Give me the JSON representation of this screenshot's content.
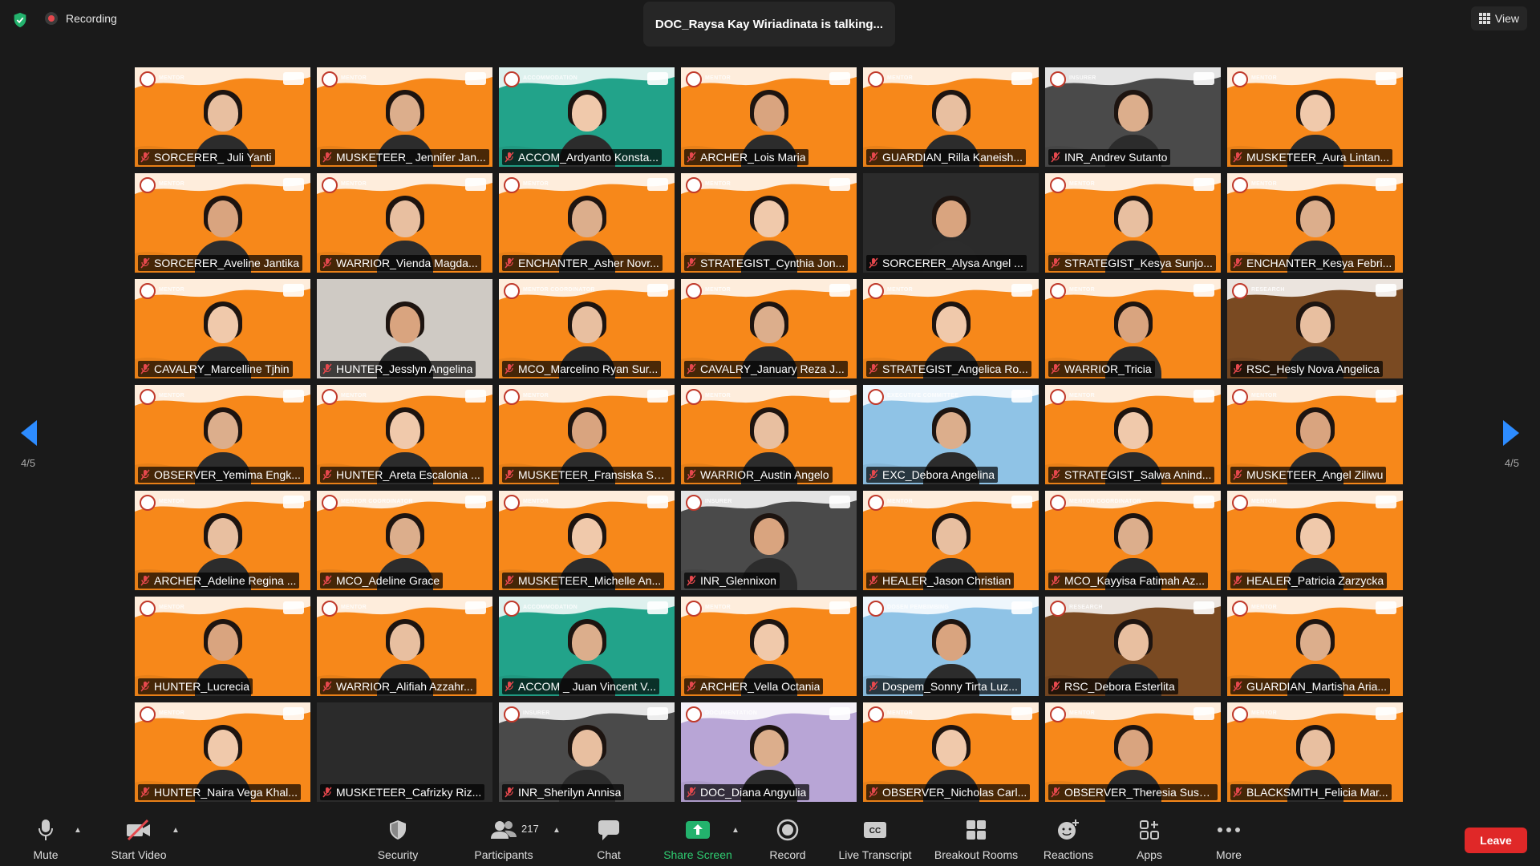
{
  "topbar": {
    "recording_label": "Recording",
    "talking_label": "DOC_Raysa Kay Wiriadinata is talking...",
    "view_label": "View"
  },
  "pager": {
    "left": "4/5",
    "right": "4/5"
  },
  "participants": [
    {
      "name": "SORCERER_ Juli Yanti",
      "role": "mentor",
      "bg": "orange"
    },
    {
      "name": "MUSKETEER_ Jennifer Jan...",
      "role": "mentor",
      "bg": "orange"
    },
    {
      "name": "ACCOM_Ardyanto Konsta...",
      "role": "accommodation",
      "bg": "teal"
    },
    {
      "name": "ARCHER_Lois Maria",
      "role": "mentor",
      "bg": "orange"
    },
    {
      "name": "GUARDIAN_Rilla Kaneish...",
      "role": "mentor",
      "bg": "orange"
    },
    {
      "name": "INR_Andrev Sutanto",
      "role": "insurer",
      "bg": "gray"
    },
    {
      "name": "MUSKETEER_Aura Lintan...",
      "role": "mentor",
      "bg": "orange"
    },
    {
      "name": "SORCERER_Aveline Jantika",
      "role": "mentor",
      "bg": "orange"
    },
    {
      "name": "WARRIOR_Vienda Magda...",
      "role": "mentor",
      "bg": "orange"
    },
    {
      "name": "ENCHANTER_Asher Novr...",
      "role": "mentor",
      "bg": "orange"
    },
    {
      "name": "STRATEGIST_Cynthia Jon...",
      "role": "mentor",
      "bg": "orange"
    },
    {
      "name": "SORCERER_Alysa Angel ...",
      "role": "mentor",
      "bg": "plain"
    },
    {
      "name": "STRATEGIST_Kesya Sunjo...",
      "role": "mentor",
      "bg": "orange"
    },
    {
      "name": "ENCHANTER_Kesya Febri...",
      "role": "mentor",
      "bg": "orange"
    },
    {
      "name": "CAVALRY_Marcelline Tjhin",
      "role": "mentor",
      "bg": "orange"
    },
    {
      "name": "HUNTER_Jesslyn Angelina",
      "role": "",
      "bg": "bg-cam"
    },
    {
      "name": "MCO_Marcelino Ryan Sur...",
      "role": "mentor coordinator",
      "bg": "orange"
    },
    {
      "name": "CAVALRY_January Reza J...",
      "role": "mentor",
      "bg": "orange"
    },
    {
      "name": "STRATEGIST_Angelica Ro...",
      "role": "mentor",
      "bg": "orange"
    },
    {
      "name": "WARRIOR_Tricia",
      "role": "mentor",
      "bg": "orange"
    },
    {
      "name": "RSC_Hesly Nova Angelica",
      "role": "research",
      "bg": "brown"
    },
    {
      "name": "OBSERVER_Yemima Engk...",
      "role": "mentor",
      "bg": "orange"
    },
    {
      "name": "HUNTER_Areta Escalonia ...",
      "role": "mentor",
      "bg": "orange"
    },
    {
      "name": "MUSKETEER_Fransiska Sz...",
      "role": "mentor",
      "bg": "orange"
    },
    {
      "name": "WARRIOR_Austin Angelo",
      "role": "mentor",
      "bg": "orange"
    },
    {
      "name": "EXC_Debora Angelina",
      "role": "executive committee",
      "bg": "blue"
    },
    {
      "name": "STRATEGIST_Salwa Anind...",
      "role": "mentor",
      "bg": "orange"
    },
    {
      "name": "MUSKETEER_Angel Ziliwu",
      "role": "mentor",
      "bg": "orange"
    },
    {
      "name": "ARCHER_Adeline Regina ...",
      "role": "mentor",
      "bg": "orange"
    },
    {
      "name": "MCO_Adeline Grace",
      "role": "mentor coordinator",
      "bg": "orange"
    },
    {
      "name": "MUSKETEER_Michelle An...",
      "role": "mentor",
      "bg": "orange"
    },
    {
      "name": "INR_Glennixon",
      "role": "insurer",
      "bg": "gray"
    },
    {
      "name": "HEALER_Jason Christian",
      "role": "mentor",
      "bg": "orange"
    },
    {
      "name": "MCO_Kayyisa Fatimah Az...",
      "role": "mentor coordinator",
      "bg": "orange"
    },
    {
      "name": "HEALER_Patricia Zarzycka",
      "role": "mentor",
      "bg": "orange"
    },
    {
      "name": "HUNTER_Lucrecia",
      "role": "mentor",
      "bg": "orange"
    },
    {
      "name": "WARRIOR_Alifiah Azzahr...",
      "role": "mentor",
      "bg": "orange"
    },
    {
      "name": "ACCOM _ Juan Vincent V...",
      "role": "accommodation",
      "bg": "teal"
    },
    {
      "name": "ARCHER_Vella Octania",
      "role": "mentor",
      "bg": "orange"
    },
    {
      "name": "Dospem_Sonny Tirta Luz...",
      "role": "dosen pembimbing",
      "bg": "blue"
    },
    {
      "name": "RSC_Debora Esterlita",
      "role": "research",
      "bg": "brown"
    },
    {
      "name": "GUARDIAN_Martisha Aria...",
      "role": "mentor",
      "bg": "orange"
    },
    {
      "name": "HUNTER_Naira Vega Khal...",
      "role": "mentor",
      "bg": "orange"
    },
    {
      "name": "MUSKETEER_Cafrizky Riz...",
      "role": "",
      "bg": "plain",
      "noVideo": true
    },
    {
      "name": "INR_Sherilyn Annisa",
      "role": "insurer",
      "bg": "gray"
    },
    {
      "name": "DOC_Diana Angyulia",
      "role": "documentation",
      "bg": "lav"
    },
    {
      "name": "OBSERVER_Nicholas Carl...",
      "role": "mentor",
      "bg": "orange"
    },
    {
      "name": "OBSERVER_Theresia Susa...",
      "role": "mentor",
      "bg": "orange"
    },
    {
      "name": "BLACKSMITH_Felicia Mar...",
      "role": "mentor",
      "bg": "orange"
    }
  ],
  "toolbar": {
    "mute": "Mute",
    "start_video": "Start Video",
    "security": "Security",
    "participants": "Participants",
    "participants_count": "217",
    "chat": "Chat",
    "share_screen": "Share Screen",
    "record": "Record",
    "live_transcript": "Live Transcript",
    "breakout_rooms": "Breakout Rooms",
    "reactions": "Reactions",
    "apps": "Apps",
    "more": "More",
    "leave": "Leave"
  },
  "colors": {
    "mentor_orange": "#f7881a",
    "accent_green": "#2ecc71",
    "leave_red": "#e02828",
    "arrow_blue": "#2d8cff"
  }
}
